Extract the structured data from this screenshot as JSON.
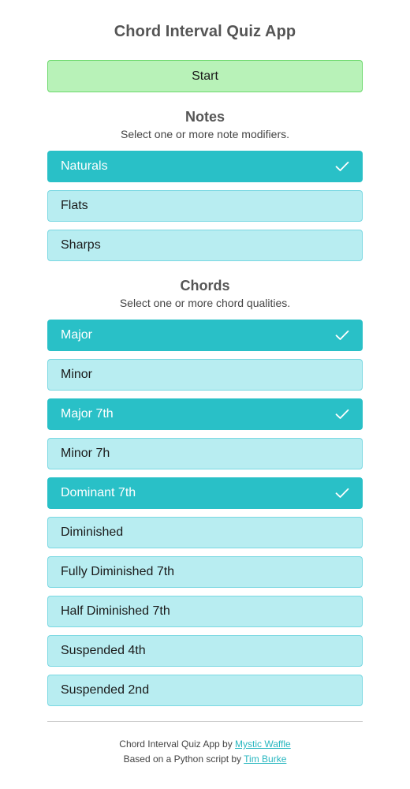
{
  "header": {
    "title": "Chord Interval Quiz App"
  },
  "start_button": {
    "label": "Start",
    "color": "#b8f2b8"
  },
  "colors": {
    "selected": "#29c0c7",
    "unselected": "#b8edf1",
    "link": "#29b7c0"
  },
  "notes": {
    "title": "Notes",
    "subtitle": "Select one or more note modifiers.",
    "options": [
      {
        "label": "Naturals",
        "selected": true
      },
      {
        "label": "Flats",
        "selected": false
      },
      {
        "label": "Sharps",
        "selected": false
      }
    ]
  },
  "chords": {
    "title": "Chords",
    "subtitle": "Select one or more chord qualities.",
    "options": [
      {
        "label": "Major",
        "selected": true
      },
      {
        "label": "Minor",
        "selected": false
      },
      {
        "label": "Major 7th",
        "selected": true
      },
      {
        "label": "Minor 7h",
        "selected": false
      },
      {
        "label": "Dominant 7th",
        "selected": true
      },
      {
        "label": "Diminished",
        "selected": false
      },
      {
        "label": "Fully Diminished 7th",
        "selected": false
      },
      {
        "label": "Half Diminished 7th",
        "selected": false
      },
      {
        "label": "Suspended 4th",
        "selected": false
      },
      {
        "label": "Suspended 2nd",
        "selected": false
      }
    ]
  },
  "footer": {
    "line1_text": "Chord Interval Quiz App by ",
    "line1_link": "Mystic Waffle",
    "line2_text": "Based on a Python script by ",
    "line2_link": "Tim Burke"
  },
  "icons": {
    "check": "check-icon"
  }
}
